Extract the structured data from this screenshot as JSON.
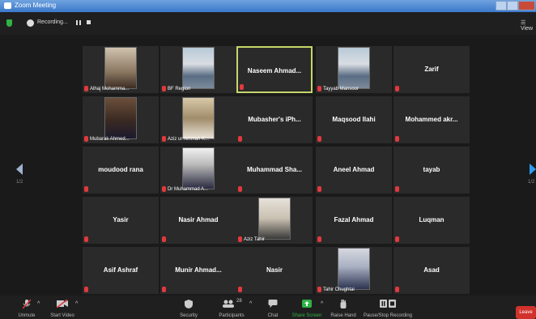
{
  "window": {
    "title": "Zoom Meeting"
  },
  "status": {
    "recording_label": "Recording...",
    "view_label": "View"
  },
  "paging": {
    "left": "1/2",
    "right": "1/2"
  },
  "tiles": [
    {
      "name": "",
      "label": "Alhaj Mohamma...",
      "photo": "beige",
      "active": false
    },
    {
      "name": "",
      "label": "BF Region",
      "photo": "church",
      "active": false
    },
    {
      "name": "Naseem  Ahmad...",
      "label": "",
      "photo": "",
      "active": true
    },
    {
      "name": "",
      "label": "Tayyab Mansoor",
      "photo": "church",
      "active": false
    },
    {
      "name": "Zarif",
      "label": "",
      "photo": "",
      "active": false
    },
    {
      "name": "",
      "label": "Mubarak Ahmed...",
      "photo": "room",
      "active": false
    },
    {
      "name": "",
      "label": "Aziz ur rehman K...",
      "photo": "boy",
      "active": false
    },
    {
      "name": "Mubasher's  iPh...",
      "label": "",
      "photo": "",
      "active": false
    },
    {
      "name": "Maqsood Ilahi",
      "label": "",
      "photo": "",
      "active": false
    },
    {
      "name": "Mohammed  akr...",
      "label": "",
      "photo": "",
      "active": false
    },
    {
      "name": "moudood rana",
      "label": "",
      "photo": "",
      "active": false
    },
    {
      "name": "",
      "label": "Dr Muhammad A...",
      "photo": "couple",
      "active": false
    },
    {
      "name": "Muhammad  Sha...",
      "label": "",
      "photo": "",
      "active": false
    },
    {
      "name": "Aneel Ahmad",
      "label": "",
      "photo": "",
      "active": false
    },
    {
      "name": "tayab",
      "label": "",
      "photo": "",
      "active": false
    },
    {
      "name": "Yasir",
      "label": "",
      "photo": "",
      "active": false
    },
    {
      "name": "Nasir Ahmad",
      "label": "",
      "photo": "",
      "active": false
    },
    {
      "name": "",
      "label": "Aziz Tahir",
      "photo": "elder",
      "active": false
    },
    {
      "name": "Fazal Ahmad",
      "label": "",
      "photo": "",
      "active": false
    },
    {
      "name": "Luqman",
      "label": "",
      "photo": "",
      "active": false
    },
    {
      "name": "Asif Ashraf",
      "label": "",
      "photo": "",
      "active": false
    },
    {
      "name": "Munir  Ahmad...",
      "label": "",
      "photo": "",
      "active": false
    },
    {
      "name": "Nasir",
      "label": "",
      "photo": "",
      "active": false
    },
    {
      "name": "",
      "label": "Tahir Chughtai",
      "photo": "suit",
      "active": false
    },
    {
      "name": "Asad",
      "label": "",
      "photo": "",
      "active": false
    }
  ],
  "toolbar": {
    "unmute": "Unmute",
    "start_video": "Start Video",
    "security": "Security",
    "participants": "Participants",
    "participants_count": "28",
    "chat": "Chat",
    "share_screen": "Share Screen",
    "raise_hand": "Raise Hand",
    "pause_recording": "Pause/Stop Recording",
    "leave": "Leave"
  },
  "colors": {
    "accent_green": "#2fb344",
    "leave_red": "#d1322c",
    "active_border": "#c4d86a",
    "muted_red": "#e0393e"
  }
}
